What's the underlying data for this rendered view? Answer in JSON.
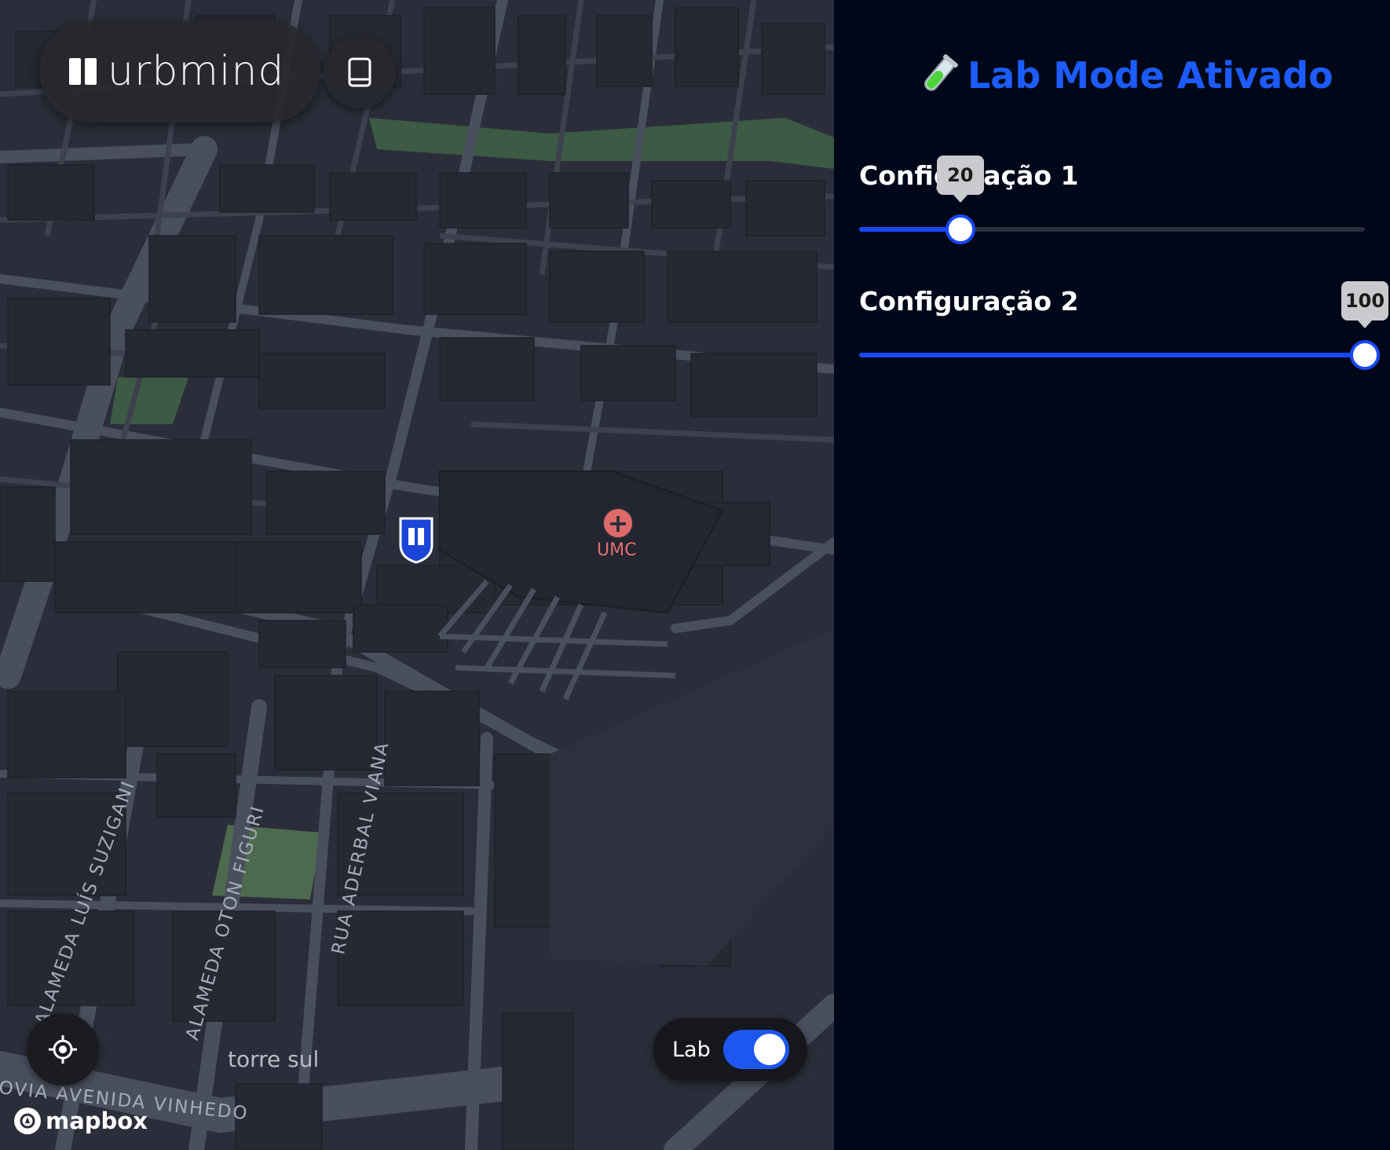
{
  "app": {
    "brand": "urbmind"
  },
  "map": {
    "poi": {
      "name": "UMC",
      "icon": "hospital-cross-icon"
    },
    "streets": [
      "ALAMEDA LUÍS SUZIGANI",
      "ALAMEDA OTON FIGURI",
      "RUA ADERBAL VIANA",
      "OVIA AVENIDA VINHEDO"
    ],
    "place": "torre sul",
    "attribution": "mapbox",
    "lab_toggle": {
      "label": "Lab",
      "on": true
    }
  },
  "panel": {
    "title": "Lab Mode Ativado",
    "title_icon": "test-tube-icon",
    "settings": [
      {
        "label": "Configuração 1",
        "value": "20",
        "min": 0,
        "max": 100
      },
      {
        "label": "Configuração 2",
        "value": "100",
        "min": 0,
        "max": 100
      }
    ]
  },
  "colors": {
    "accent": "#1c5cff",
    "panel_bg": "#000718",
    "map_bg": "#2b2e3a",
    "building": "#262834",
    "road": "#4a4f5d",
    "park": "#3c5a44",
    "poi": "#e06a6a"
  }
}
